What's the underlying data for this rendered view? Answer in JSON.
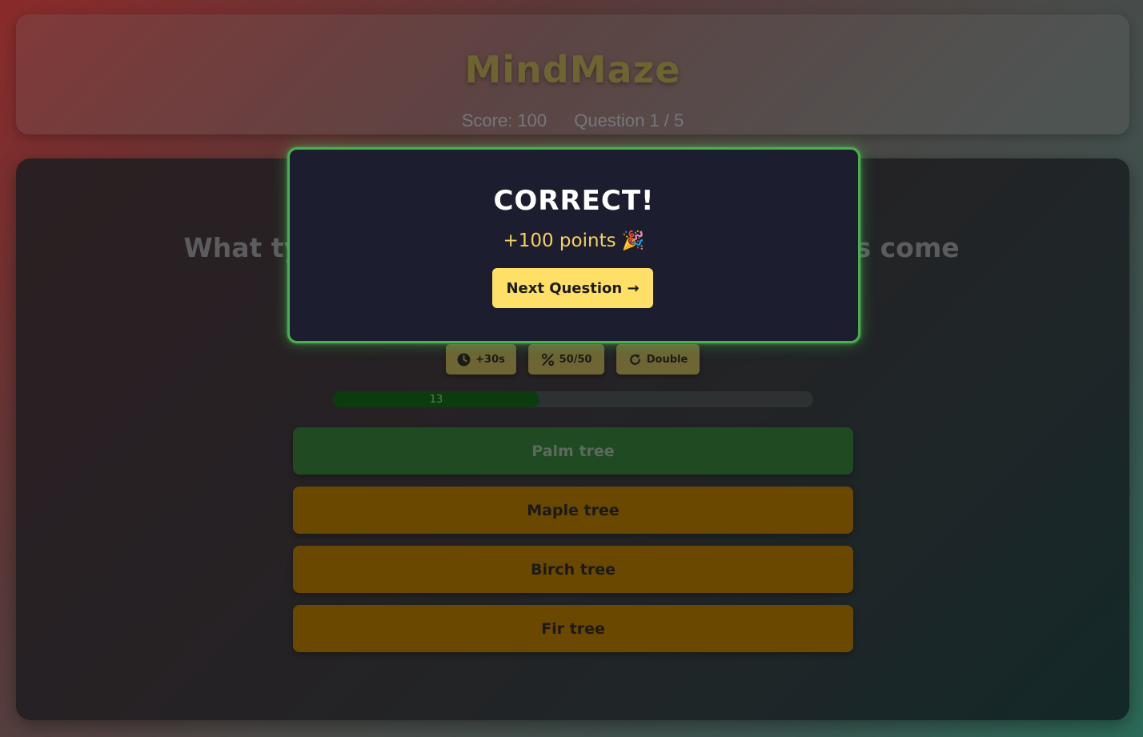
{
  "header": {
    "title": "MindMaze",
    "score_text": "Score: 100",
    "question_progress": "Question 1 / 5"
  },
  "question": {
    "text": "What type of tree do both dates and coconuts come"
  },
  "powerups": [
    {
      "label": "+30s",
      "icon": "clock-icon"
    },
    {
      "label": "50/50",
      "icon": "percent-icon"
    },
    {
      "label": "Double",
      "icon": "rotate-icon"
    }
  ],
  "timer": {
    "value": "13",
    "fraction_remaining": 0.43
  },
  "answers": [
    {
      "label": "Palm tree",
      "state": "correct"
    },
    {
      "label": "Maple tree",
      "state": "normal"
    },
    {
      "label": "Birch tree",
      "state": "normal"
    },
    {
      "label": "Fir tree",
      "state": "normal"
    }
  ],
  "modal": {
    "title": "CORRECT!",
    "points": "+100 points 🎉",
    "next_label": "Next Question →"
  },
  "colors": {
    "correct_border": "#49b04f",
    "accent_yellow": "#ffe066",
    "answer_bg": "#6a4800",
    "correct_answer_bg": "#1f4a22"
  }
}
